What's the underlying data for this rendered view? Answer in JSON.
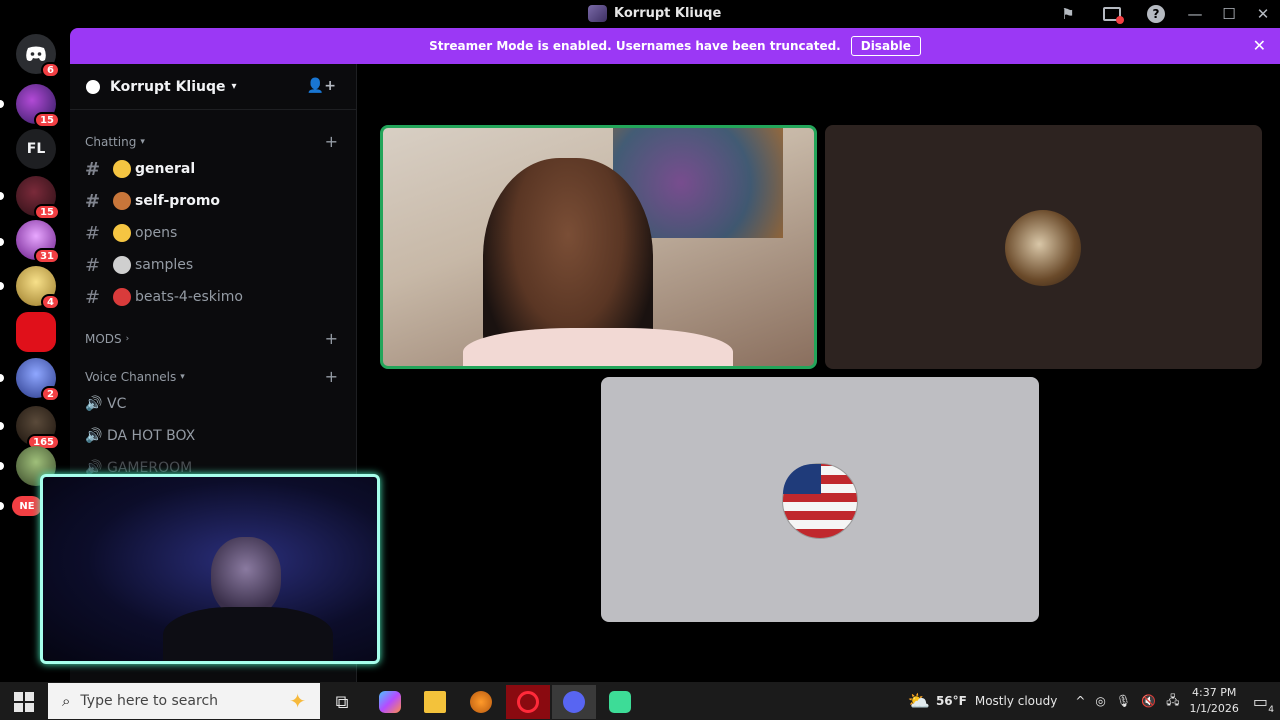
{
  "window": {
    "title": "Korrupt Kliuqe"
  },
  "banner": {
    "text": "Streamer Mode is enabled. Usernames have been truncated.",
    "disable_label": "Disable"
  },
  "rail": {
    "badges": [
      "6",
      "15",
      "15",
      "31",
      "4",
      "2",
      "165"
    ],
    "folder_label": "FL",
    "new_label": "NE"
  },
  "sidebar": {
    "server_name": "Korrupt Kliuqe",
    "categories": {
      "chatting": "Chatting",
      "mods": "MODS",
      "voice": "Voice Channels"
    },
    "text_channels": [
      {
        "label": "general",
        "emoji_color": "#f5c542"
      },
      {
        "label": "self-promo",
        "emoji_color": "#c8763a"
      },
      {
        "label": "opens",
        "emoji_color": "#f5c542"
      },
      {
        "label": "samples",
        "emoji_color": "#cfcfcf"
      },
      {
        "label": "beats-4-eskimo",
        "emoji_color": "#d93b3b"
      }
    ],
    "voice_channels": [
      "VC",
      "DA HOT BOX",
      "GAMEROOM"
    ]
  },
  "taskbar": {
    "search_placeholder": "Type here to search",
    "weather_temp": "56°F",
    "weather_desc": "Mostly cloudy",
    "time": "4:37 PM",
    "date": "1/1/2026",
    "notif_count": "4"
  },
  "colors": {
    "accent": "#9b38f5",
    "speaking": "#23a55a",
    "cam_glow": "#a6ffec",
    "mention": "#f23f43"
  }
}
